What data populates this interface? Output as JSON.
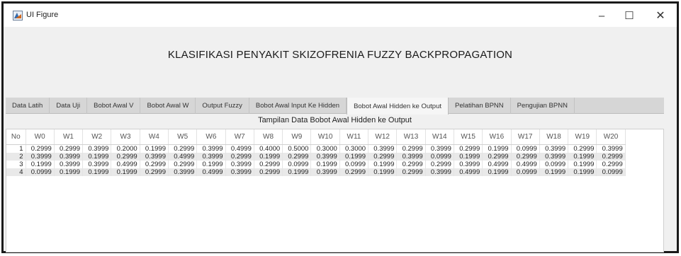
{
  "window": {
    "title": "UI Figure",
    "minimize_glyph": "–",
    "maximize_glyph": "☐",
    "close_glyph": "✕"
  },
  "heading": "KLASIFIKASI PENYAKIT SKIZOFRENIA FUZZY BACKPROPAGATION",
  "tabs": [
    {
      "label": "Data Latih"
    },
    {
      "label": "Data Uji"
    },
    {
      "label": "Bobot Awal V"
    },
    {
      "label": "Bobot Awal W"
    },
    {
      "label": "Output Fuzzy"
    },
    {
      "label": "Bobot Awal Input Ke Hidden"
    },
    {
      "label": "Bobot Awal Hidden ke Output",
      "active": true
    },
    {
      "label": "Pelatihan BPNN"
    },
    {
      "label": "Pengujian BPNN"
    }
  ],
  "table": {
    "caption": "Tampilan Data  Bobot Awal Hidden ke Output",
    "columns": [
      "No",
      "W0",
      "W1",
      "W2",
      "W3",
      "W4",
      "W5",
      "W6",
      "W7",
      "W8",
      "W9",
      "W10",
      "W11",
      "W12",
      "W13",
      "W14",
      "W15",
      "W16",
      "W17",
      "W18",
      "W19",
      "W20"
    ],
    "rows": [
      [
        "1",
        "0.2999",
        "0.2999",
        "0.3999",
        "0.2000",
        "0.1999",
        "0.2999",
        "0.3999",
        "0.4999",
        "0.4000",
        "0.5000",
        "0.3000",
        "0.3000",
        "0.3999",
        "0.2999",
        "0.3999",
        "0.2999",
        "0.1999",
        "0.0999",
        "0.3999",
        "0.2999",
        "0.3999"
      ],
      [
        "2",
        "0.3999",
        "0.3999",
        "0.1999",
        "0.2999",
        "0.3999",
        "0.4999",
        "0.3999",
        "0.2999",
        "0.1999",
        "0.2999",
        "0.3999",
        "0.1999",
        "0.2999",
        "0.3999",
        "0.0999",
        "0.1999",
        "0.2999",
        "0.2999",
        "0.3999",
        "0.1999",
        "0.2999"
      ],
      [
        "3",
        "0.1999",
        "0.3999",
        "0.3999",
        "0.4999",
        "0.2999",
        "0.2999",
        "0.1999",
        "0.3999",
        "0.2999",
        "0.0999",
        "0.1999",
        "0.0999",
        "0.1999",
        "0.2999",
        "0.2999",
        "0.3999",
        "0.4999",
        "0.4999",
        "0.0999",
        "0.1999",
        "0.2999"
      ],
      [
        "4",
        "0.0999",
        "0.1999",
        "0.1999",
        "0.1999",
        "0.2999",
        "0.3999",
        "0.4999",
        "0.3999",
        "0.2999",
        "0.1999",
        "0.3999",
        "0.2999",
        "0.1999",
        "0.2999",
        "0.3999",
        "0.4999",
        "0.1999",
        "0.0999",
        "0.1999",
        "0.1999",
        "0.0999"
      ]
    ]
  }
}
